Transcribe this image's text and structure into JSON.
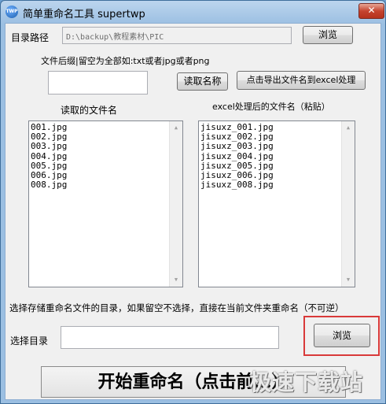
{
  "window": {
    "title": "简单重命名工具 supertwp",
    "icon_text": "TWP",
    "close_label": "✕"
  },
  "dir": {
    "label": "目录路径",
    "path_value": "D:\\backup\\教程素材\\PIC",
    "browse_label": "浏览"
  },
  "suffix": {
    "hint": "文件后缀|留空为全部如:txt或者jpg或者png",
    "value": "",
    "read_names_label": "读取名称",
    "export_label": "点击导出文件名到excel处理"
  },
  "lists": {
    "left_header": "读取的文件名",
    "right_header": "excel处理后的文件名（粘贴）",
    "left_items": [
      "001.jpg",
      "002.jpg",
      "003.jpg",
      "004.jpg",
      "005.jpg",
      "006.jpg",
      "008.jpg"
    ],
    "right_items": [
      "jisuxz_001.jpg",
      "jisuxz_002.jpg",
      "jisuxz_003.jpg",
      "jisuxz_004.jpg",
      "jisuxz_005.jpg",
      "jisuxz_006.jpg",
      "jisuxz_008.jpg"
    ]
  },
  "output": {
    "note": "选择存储重命名文件的目录，如果留空不选择，直接在当前文件夹重命名（不可逆）",
    "label": "选择目录",
    "value": "",
    "browse_label": "浏览"
  },
  "start": {
    "label": "开始重命名（点击前...）"
  },
  "watermark": "极速下载站",
  "colors": {
    "highlight": "#d93a3a",
    "title_gradient_top": "#bcd5ee"
  }
}
